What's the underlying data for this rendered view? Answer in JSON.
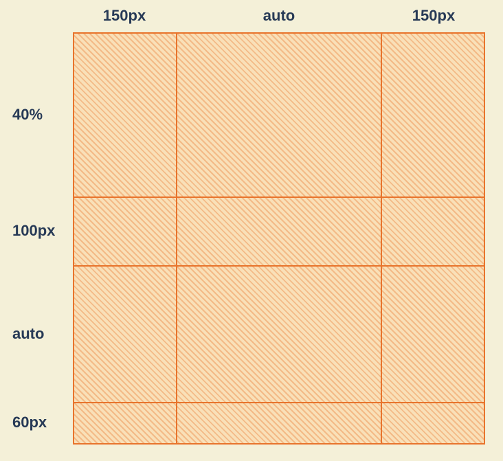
{
  "columns": {
    "c1": "150px",
    "c2": "auto",
    "c3": "150px"
  },
  "rows": {
    "r1": "40%",
    "r2": "100px",
    "r3": "auto",
    "r4": "60px"
  }
}
